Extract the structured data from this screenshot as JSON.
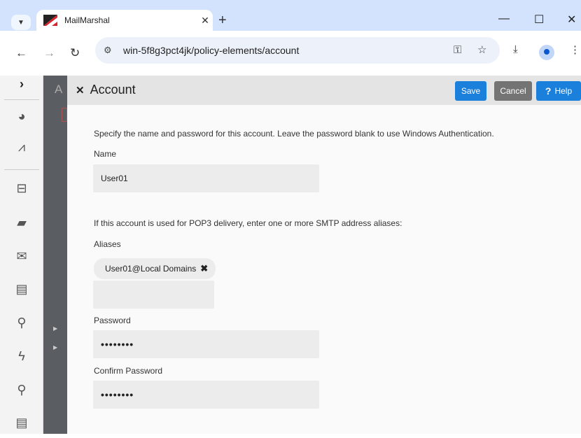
{
  "browser": {
    "tab_title": "MailMarshal",
    "url": "win-5f8g3pct4jk/policy-elements/account"
  },
  "icons": {
    "tab_dropdown": "chevron-down-icon",
    "tab_close": "close-icon",
    "new_tab": "plus-icon",
    "minimize": "minimize-icon",
    "maximize": "maximize-icon",
    "close_window": "close-icon",
    "back": "arrow-left-icon",
    "forward": "arrow-right-icon",
    "reload": "reload-icon",
    "site_settings": "tune-icon",
    "passwords": "key-icon",
    "bookmark": "star-icon",
    "downloads": "download-icon",
    "profile": "profile-icon",
    "menu": "more-vertical-icon"
  },
  "background": {
    "letter": "A"
  },
  "panel": {
    "title": "Account",
    "save_label": "Save",
    "cancel_label": "Cancel",
    "help_label": "Help",
    "intro": "Specify the name and password for this account.  Leave the password blank to use Windows Authentication.",
    "name_label": "Name",
    "name_value": "User01",
    "pop3_note": "If this account is used for POP3 delivery, enter one or more SMTP address aliases:",
    "aliases_label": "Aliases",
    "aliases": [
      "User01@Local Domains"
    ],
    "alias_input_value": "",
    "password_label": "Password",
    "password_value": "••••••••",
    "confirm_label": "Confirm Password",
    "confirm_value": "••••••••"
  },
  "colors": {
    "primary_button": "#1b7fdc",
    "cancel_button": "#747474",
    "tabbar": "#d3e3fd"
  }
}
